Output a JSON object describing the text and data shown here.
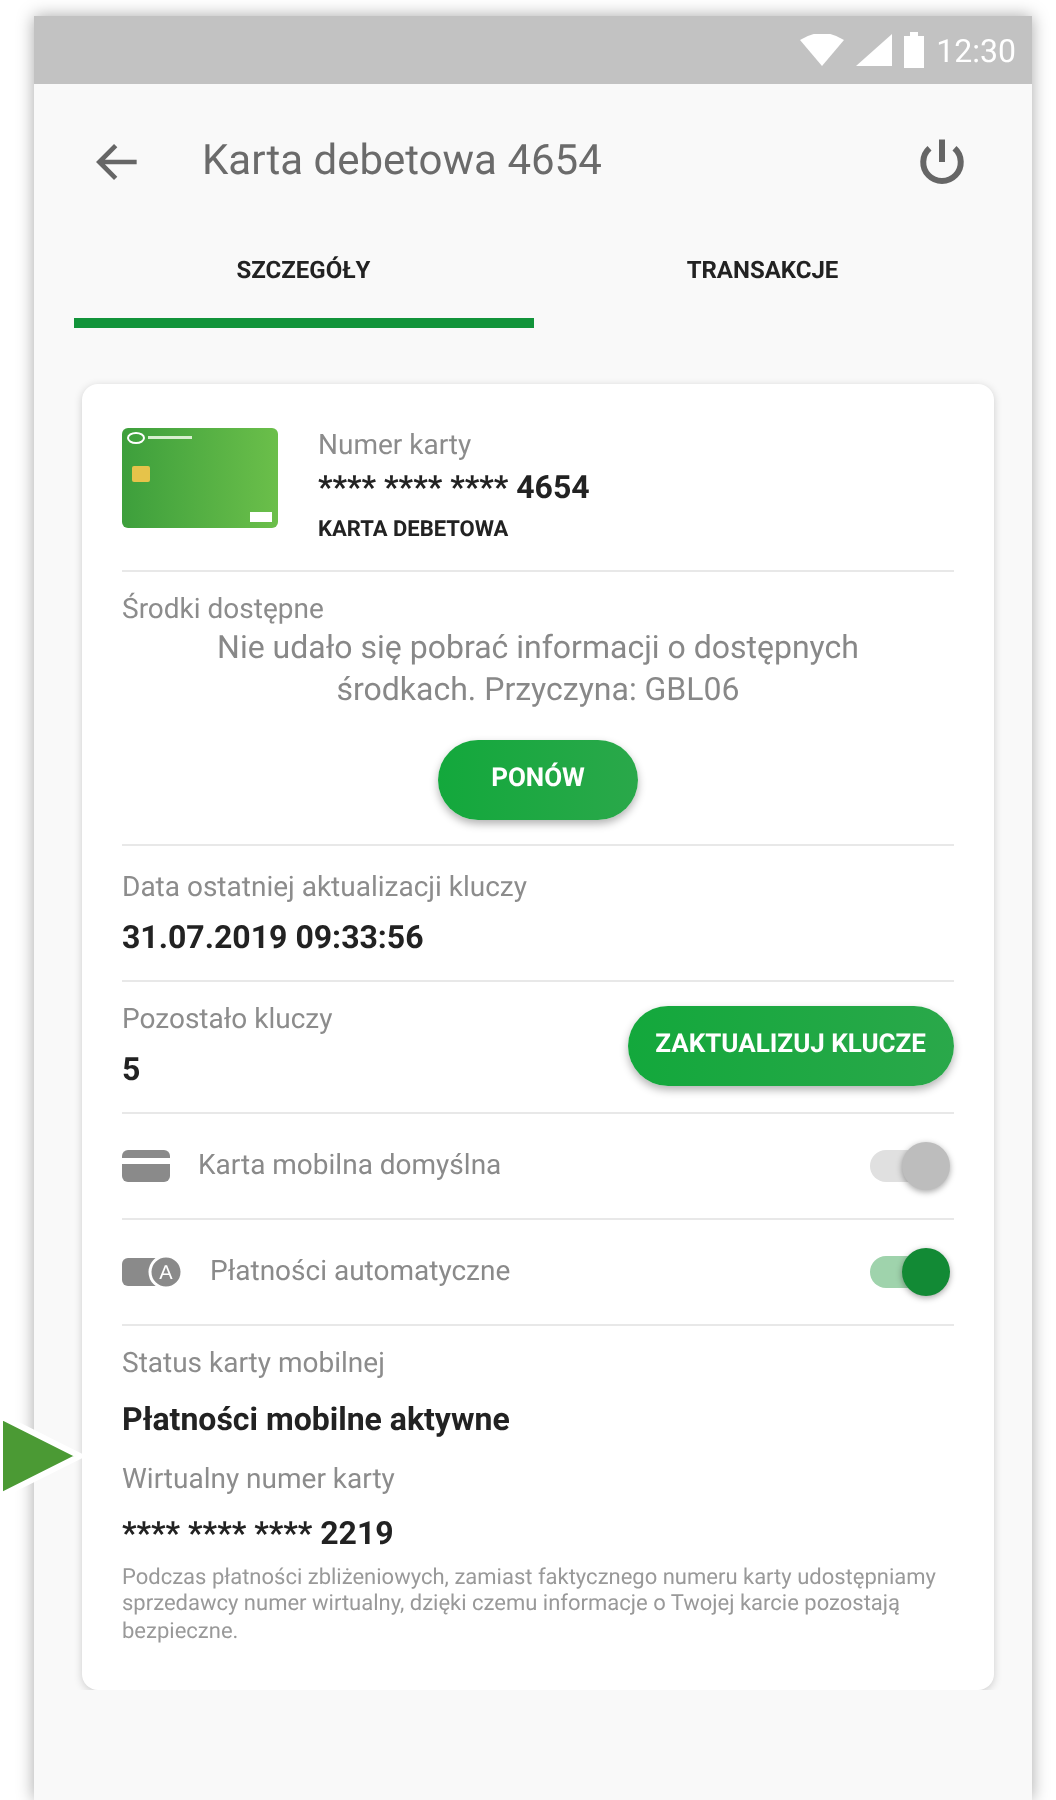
{
  "status_bar": {
    "time": "12:30"
  },
  "header": {
    "title": "Karta debetowa 4654"
  },
  "tabs": [
    {
      "label": "SZCZEGÓŁY",
      "selected": true
    },
    {
      "label": "TRANSAKCJE",
      "selected": false
    }
  ],
  "card": {
    "number_label": "Numer karty",
    "number": "**** **** **** 4654",
    "type": "KARTA DEBETOWA"
  },
  "funds": {
    "label": "Środki dostępne",
    "message": "Nie udało się pobrać informacji o dostępnych środkach. Przyczyna: GBL06",
    "retry_button": "PONÓW"
  },
  "keys": {
    "date_label": "Data ostatniej aktualizacji kluczy",
    "date": "31.07.2019 09:33:56",
    "remaining_label": "Pozostało kluczy",
    "remaining": "5",
    "update_button": "ZAKTUALIZUJ KLUCZE"
  },
  "toggles": [
    {
      "kind": "card",
      "label": "Karta mobilna domyślna",
      "on": true,
      "disabled": true
    },
    {
      "kind": "auto",
      "badge": "A",
      "label": "Płatności automatyczne",
      "on": true,
      "disabled": false
    }
  ],
  "mobile": {
    "status_label": "Status karty mobilnej",
    "status": "Płatności mobilne aktywne",
    "virtual_label": "Wirtualny numer karty",
    "virtual_number": "**** **** **** 2219",
    "note": "Podczas płatności zbliżeniowych, zamiast faktycznego numeru karty udostępniamy sprzedawcy numer wirtualny, dzięki czemu informacje o Twojej karcie pozostają bezpieczne."
  }
}
